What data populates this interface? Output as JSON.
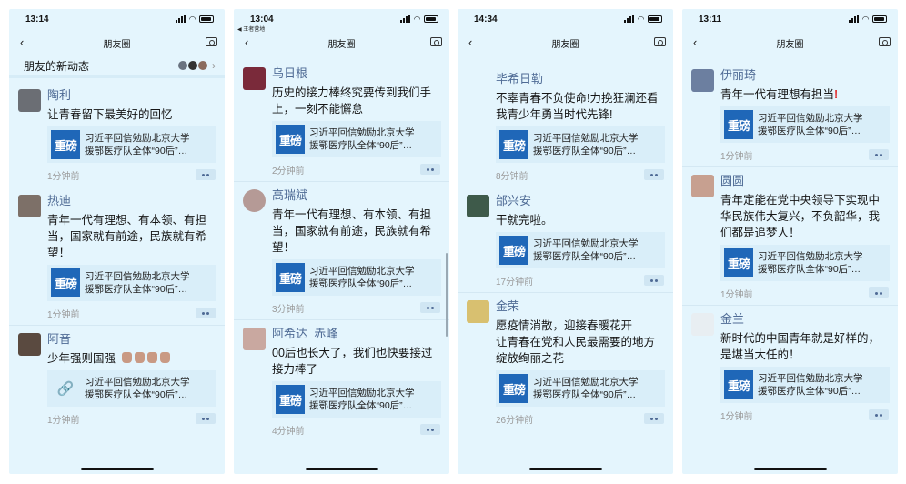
{
  "nav_title": "朋友圈",
  "new_updates": "朋友的新动态",
  "article_title_line1": "习近平回信勉励北京大学",
  "article_title_line2": "援鄂医疗队全体“90后”…",
  "thumb_label": "重磅",
  "colors": {
    "name": "#4f6b95",
    "background": "#e4f5fd",
    "thumb": "#1f67b8"
  },
  "phones": [
    {
      "time": "13:14",
      "posts": [
        {
          "name": "陶利",
          "text": "让青春留下最美好的回忆",
          "ago": "1分钟前"
        },
        {
          "name": "热迪",
          "text": "青年一代有理想、有本领、有担当，国家就有前途，民族就有希望！",
          "ago": "1分钟前"
        },
        {
          "name": "阿音",
          "text": "少年强则国强",
          "ago": "1分钟前"
        }
      ]
    },
    {
      "time": "13:04",
      "back_app": "◀ 王者营地",
      "posts": [
        {
          "name": "乌日根",
          "text": "历史的接力棒终究要传到我们手上，一刻不能懈怠",
          "ago": "2分钟前"
        },
        {
          "name": "高瑞斌",
          "text": "青年一代有理想、有本领、有担当，国家就有前途，民族就有希望！",
          "ago": "3分钟前"
        },
        {
          "name": "阿希达  赤峰",
          "text": "00后也长大了，我们也快要接过接力棒了",
          "ago": "4分钟前"
        }
      ]
    },
    {
      "time": "14:34",
      "posts": [
        {
          "name": "毕希日勒",
          "text": "不辜青春不负使命!力挽狂澜还看我青少年勇当时代先锋!",
          "ago": "8分钟前"
        },
        {
          "name": "邰兴安",
          "text": "干就完啦。",
          "ago": "17分钟前"
        },
        {
          "name": "金荣",
          "text": "愿疫情消散，迎接春暖花开　　让青春在党和人民最需要的地方绽放绚丽之花",
          "ago": "26分钟前"
        }
      ]
    },
    {
      "time": "13:11",
      "posts": [
        {
          "name": "伊丽琦",
          "text": "青年一代有理想有担当",
          "ago": "1分钟前"
        },
        {
          "name": "圆圆",
          "text": "青年定能在党中央领导下实现中华民族伟大复兴，不负韶华，我们都是追梦人！",
          "ago": "1分钟前"
        },
        {
          "name": "金兰",
          "text": "新时代的中国青年就是好样的，是堪当大任的！",
          "ago": "1分钟前"
        }
      ]
    }
  ]
}
